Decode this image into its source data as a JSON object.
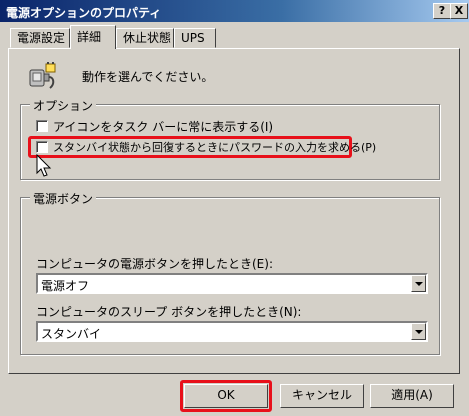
{
  "window": {
    "title": "電源オプションのプロパティ",
    "help_label": "?",
    "close_label": "X"
  },
  "tabs": [
    {
      "label": "電源設定"
    },
    {
      "label": "詳細"
    },
    {
      "label": "休止状態"
    },
    {
      "label": "UPS"
    }
  ],
  "details": {
    "prompt": "動作を選んでください。",
    "options_group": {
      "legend": "オプション",
      "checkbox1": {
        "label": "アイコンをタスク バーに常に表示する(I)",
        "checked": false
      },
      "checkbox2": {
        "label": "スタンバイ状態から回復するときにパスワードの入力を求める(P)",
        "checked": false
      }
    },
    "power_buttons_group": {
      "legend": "電源ボタン",
      "power_button": {
        "label": "コンピュータの電源ボタンを押したとき(E):",
        "value": "電源オフ"
      },
      "sleep_button": {
        "label": "コンピュータのスリープ ボタンを押したとき(N):",
        "value": "スタンバイ"
      }
    }
  },
  "buttons": {
    "ok": "OK",
    "cancel": "キャンセル",
    "apply": "適用(A)"
  },
  "colors": {
    "highlight": "#e8101a",
    "titlebar": "#0a246a"
  },
  "icons": {
    "app": "power-plug-icon",
    "cursor": "mouse-pointer-icon"
  }
}
